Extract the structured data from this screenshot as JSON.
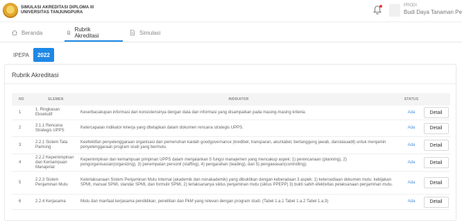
{
  "header": {
    "brand_line1": "SIMULASI AKREDITASI DIPLOMA III",
    "brand_line2": "UNIVERSITAS TANJUNGPURA",
    "prodi_label": "PRODI",
    "prodi_name": "Budi Daya Tanaman Perkebunan",
    "icons": {
      "notification": "bell-icon"
    }
  },
  "nav": {
    "tabs": [
      {
        "label": "Beranda",
        "icon": "home-icon"
      },
      {
        "label": "Rubrik Akreditasi",
        "icon": "document-icon",
        "active": true
      },
      {
        "label": "Simulasi",
        "icon": "document-icon"
      }
    ]
  },
  "years": {
    "tabs": [
      {
        "label": "IPEPA"
      },
      {
        "label": "2022",
        "active": true
      }
    ]
  },
  "colors": {
    "accent": "#1e88e5",
    "status": "#4a90d9",
    "notification_dot": "#e53935"
  },
  "rubrik": {
    "title": "Rubrik Akreditasi",
    "columns": {
      "no": "NO",
      "elemen": "ELEMEN",
      "indikator": "INDIKATOR",
      "status": "STATUS"
    },
    "detail_label": "Detail",
    "rows": [
      {
        "no": "1",
        "elemen": "1. Ringkasan Eksekutif",
        "indikator": "Keserbacakupan informasi dan konsistensinya dengan data dan informasi yang disampaikan pada masing-masing kriteria.",
        "status": "Ada"
      },
      {
        "no": "2",
        "elemen": "2.1.1 Rencana Strategis UPPS",
        "indikator": "Ketercapaian indikator kinerja yang ditetapkan dalam dokumen rencana strategis UPPS.",
        "status": "Ada"
      },
      {
        "no": "3",
        "elemen": "2.2.1 Sistem Tata Pamong",
        "indikator": "Keefektifan penyelenggaraan organisasi dan pemenuhan kaidah goodgovernance (kredibel, transparan, akuntabel, bertanggung jawab, dan/atauadil) untuk menjamin penyelenggaraan program studi yang bermutu.",
        "status": "Ada"
      },
      {
        "no": "4",
        "elemen": "2.2.2 Kepemimpinan dan Kemampuan Manajerial",
        "indikator": "Kepemimpinan dan kemampuan pimpinan UPPS dalam menjalankan 5 fungsi manajemen yang mencakup aspek: 1) perencanaan (planning), 2) pengorganisasian(organizing), 3) penempatan personil (staffing), 4) pengarahan (leading), dan 5) pengawasan(controlling).",
        "status": "Ada"
      },
      {
        "no": "5",
        "elemen": "2.2.3 Sistem Penjaminan Mutu",
        "indikator": "Keterlaksanaan Sistem Penjaminan Mutu Internal (akademik dan nonakademik) yang dibuktikan dengan keberadaan 3 aspek: 1) ketersediaan dokumen mutu: kebijakan SPMI, manual SPMI, standar SPMI, dan formulir SPMI, 2) terlaksananya siklus penjaminan mutu (siklus PPEPP) 3) bukti sahih efektivitas pelaksanaan penjaminan mutu.",
        "status": "Ada"
      },
      {
        "no": "6",
        "elemen": "2.2.4 Kerjasama",
        "indikator": "Mutu dan manfaat kerjasama pendidikan, penelitian dan PkM yang relevan dengan program studi. (Tabel 1.a.1 Tabel 1.a.2 Tabel 1.a.3)",
        "status": "Ada"
      }
    ]
  }
}
